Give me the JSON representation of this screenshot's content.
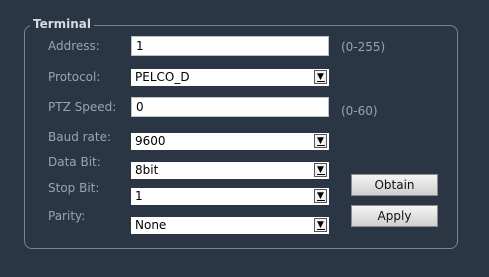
{
  "group_title": "Terminal",
  "fields": {
    "address": {
      "label": "Address:",
      "value": "1",
      "range": "(0-255)"
    },
    "protocol": {
      "label": "Protocol:",
      "value": "PELCO_D"
    },
    "ptz_speed": {
      "label": "PTZ Speed:",
      "value": "0",
      "range": "(0-60)"
    },
    "baud_rate": {
      "label": "Baud rate:",
      "value": "9600"
    },
    "data_bit": {
      "label": "Data Bit:",
      "value": "8bit"
    },
    "stop_bit": {
      "label": "Stop Bit:",
      "value": "1"
    },
    "parity": {
      "label": "Parity:",
      "value": "None"
    }
  },
  "buttons": {
    "obtain": "Obtain",
    "apply": "Apply"
  },
  "icons": {
    "dropdown": "chevron-down-icon"
  }
}
